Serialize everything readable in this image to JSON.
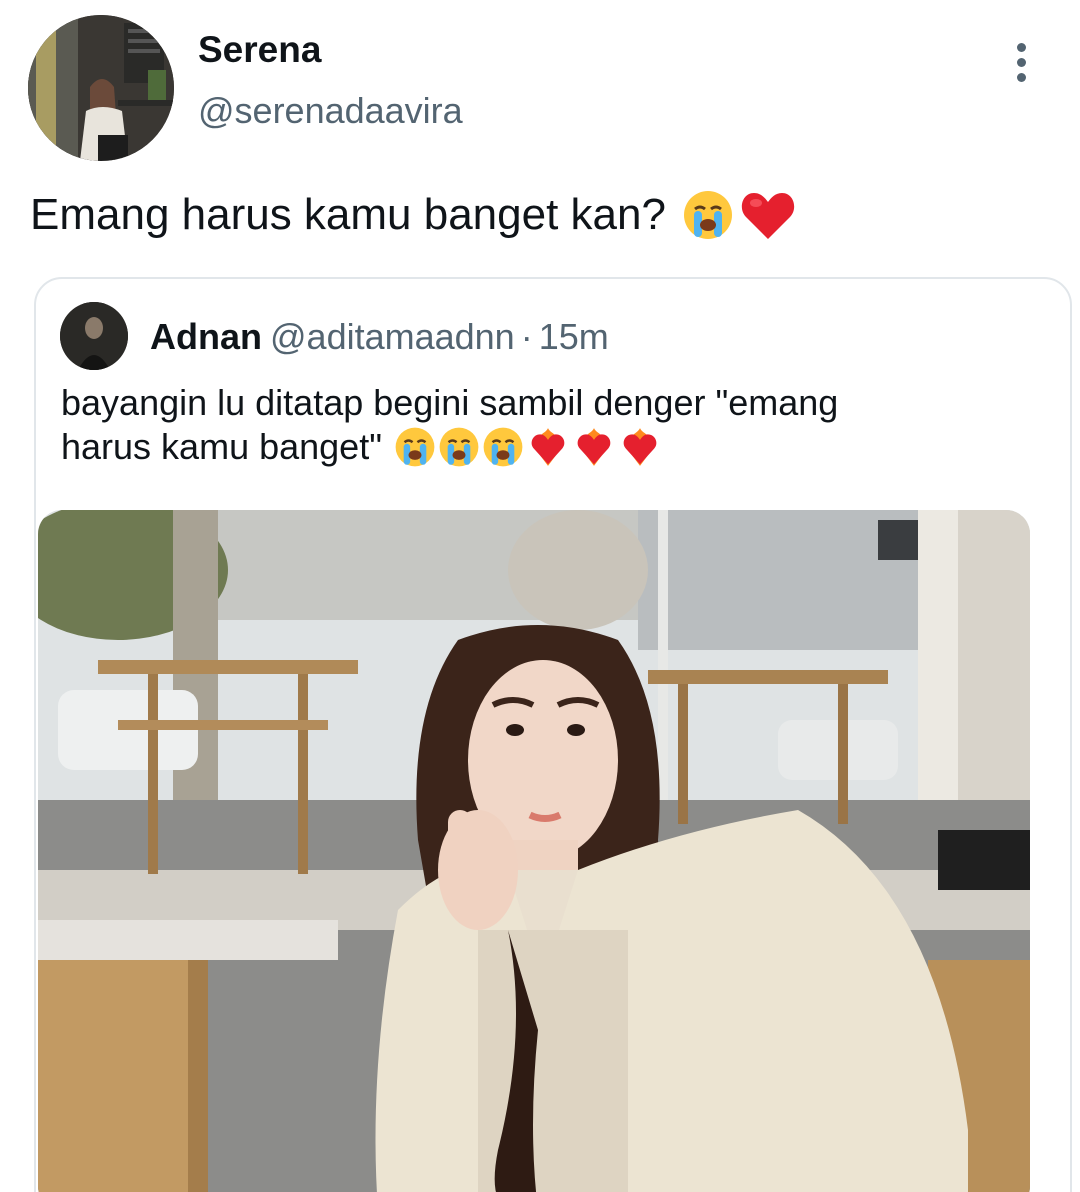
{
  "author": {
    "name": "Serena",
    "handle": "@serenadaavira"
  },
  "tweet": {
    "text": "Emang harus kamu banget kan?",
    "emojis": [
      "loudly-crying-face",
      "red-heart"
    ]
  },
  "quoted_tweet": {
    "name": "Adnan",
    "handle": "@aditamaadnn",
    "separator": "·",
    "time": "15m",
    "text_line1": "bayangin lu ditatap begini sambil denger \"emang",
    "text_line2": "harus kamu banget\"",
    "emojis": [
      "loudly-crying-face",
      "loudly-crying-face",
      "loudly-crying-face",
      "heart-on-fire",
      "heart-on-fire",
      "heart-on-fire"
    ]
  },
  "colors": {
    "primary_text": "#0f1419",
    "secondary_text": "#536471",
    "border": "#e1e6ea"
  }
}
